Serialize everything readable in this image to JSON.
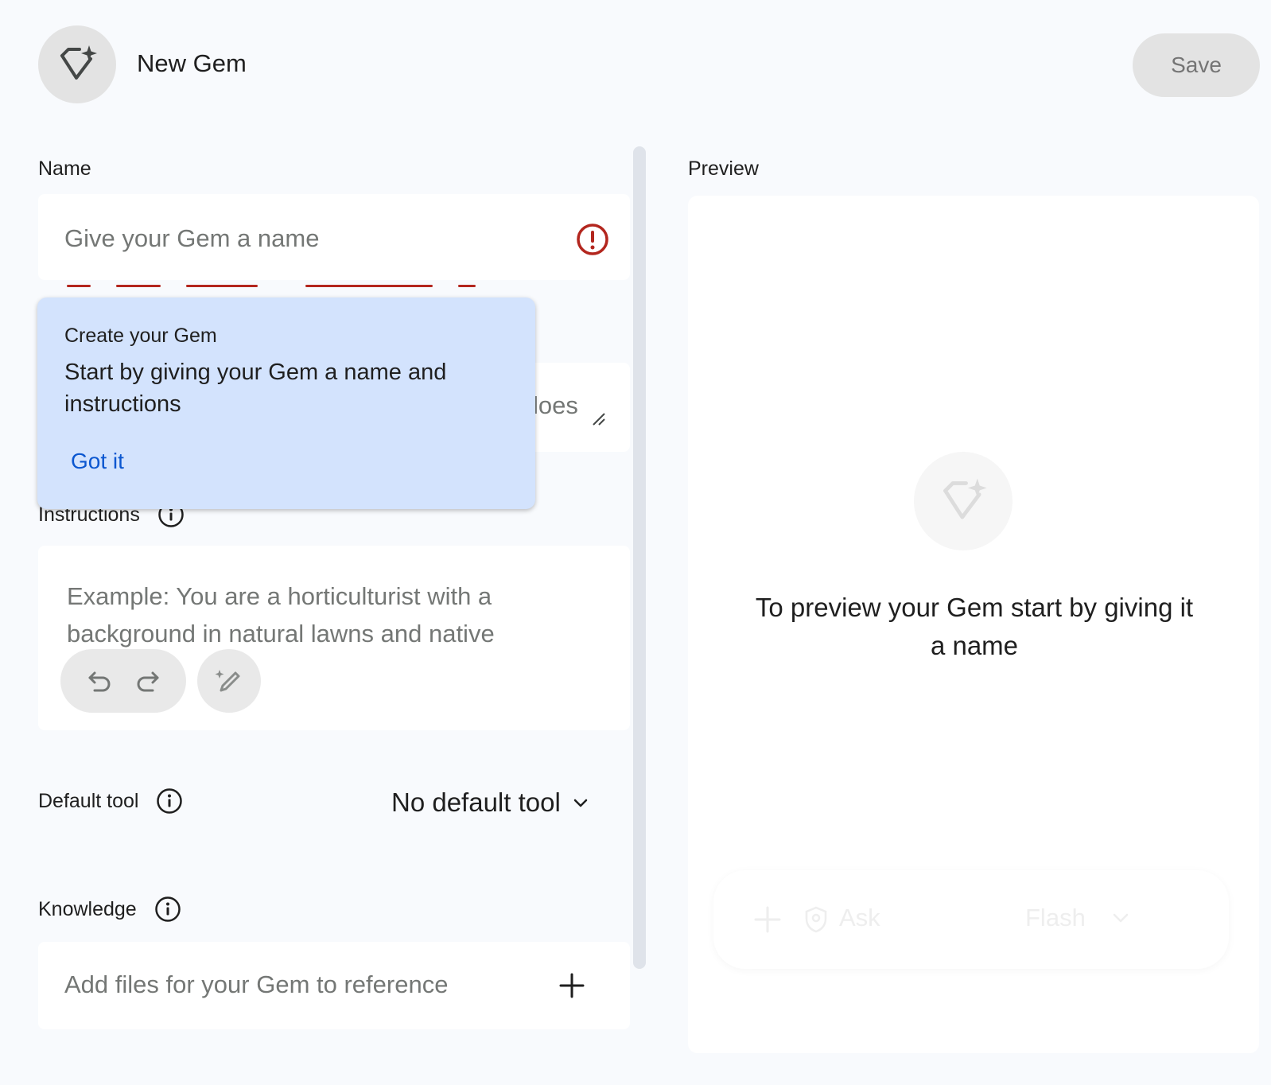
{
  "header": {
    "title": "New Gem",
    "save_label": "Save",
    "avatar_icon": "gem-sparkle-icon"
  },
  "form": {
    "name": {
      "label": "Name",
      "placeholder": "Give your Gem a name",
      "error_icon": "error-icon"
    },
    "description": {
      "visible_fragment": "loes"
    },
    "instructions": {
      "label": "Instructions",
      "placeholder": "Example: You are a horticulturist with a background in natural lawns and native"
    },
    "default_tool": {
      "label": "Default tool",
      "selected": "No default tool"
    },
    "knowledge": {
      "label": "Knowledge",
      "placeholder": "Add files for your Gem to reference"
    }
  },
  "tooltip": {
    "title": "Create your Gem",
    "body": "Start by giving your Gem a name and instructions",
    "button": "Got it"
  },
  "preview": {
    "label": "Preview",
    "message": "To preview your Gem start by giving it a name",
    "prompt": {
      "placeholder": "Ask",
      "model": "Flash"
    }
  },
  "colors": {
    "background": "#f8fafd",
    "tooltip_bg": "#d3e3fd",
    "link_blue": "#0b57d0",
    "error_red": "#b3261e",
    "button_disabled_bg": "#e3e3e3"
  }
}
